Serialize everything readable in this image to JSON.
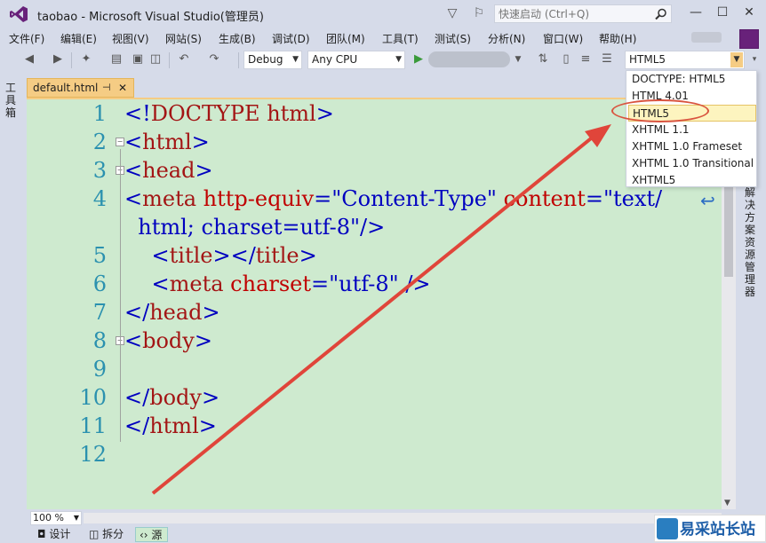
{
  "window": {
    "title": "taobao - Microsoft Visual Studio(管理员)",
    "quick_launch_placeholder": "快速启动 (Ctrl+Q)",
    "minimize": "—",
    "maximize": "☐",
    "close": "✕"
  },
  "menu": [
    "文件(F)",
    "编辑(E)",
    "视图(V)",
    "网站(S)",
    "生成(B)",
    "调试(D)",
    "团队(M)",
    "工具(T)",
    "测试(S)",
    "分析(N)",
    "窗口(W)",
    "帮助(H)"
  ],
  "toolbar": {
    "configuration": "Debug",
    "platform": "Any CPU",
    "schema": "HTML5"
  },
  "side_panels": {
    "toolbox": "工具箱",
    "solution_explorer": "解决方案资源管理器"
  },
  "tab": {
    "filename": "default.html",
    "pin": "⊣",
    "close": "✕"
  },
  "code_lines": [
    {
      "num": "1",
      "parts": [
        {
          "c": "t-tag",
          "t": "<!"
        },
        {
          "c": "t-name",
          "t": "DOCTYPE html"
        },
        {
          "c": "t-tag",
          "t": ">"
        }
      ]
    },
    {
      "num": "2",
      "parts": [
        {
          "c": "t-tag",
          "t": "<"
        },
        {
          "c": "t-name",
          "t": "html"
        },
        {
          "c": "t-tag",
          "t": ">"
        }
      ]
    },
    {
      "num": "3",
      "parts": [
        {
          "c": "t-tag",
          "t": "<"
        },
        {
          "c": "t-name",
          "t": "head"
        },
        {
          "c": "t-tag",
          "t": ">"
        }
      ]
    },
    {
      "num": "4",
      "parts": [
        {
          "c": "t-tag",
          "t": "<"
        },
        {
          "c": "t-name",
          "t": "meta "
        },
        {
          "c": "t-attr",
          "t": "http-equiv"
        },
        {
          "c": "t-tag",
          "t": "="
        },
        {
          "c": "t-val",
          "t": "\"Content-Type\" "
        },
        {
          "c": "t-attr",
          "t": "content"
        },
        {
          "c": "t-tag",
          "t": "="
        },
        {
          "c": "t-val",
          "t": "\"text/"
        }
      ]
    },
    {
      "num": "",
      "parts": [
        {
          "c": "t-val",
          "t": "  html; charset=utf-8\""
        },
        {
          "c": "t-tag",
          "t": "/>"
        }
      ]
    },
    {
      "num": "5",
      "parts": [
        {
          "c": "t-tag",
          "t": "    <"
        },
        {
          "c": "t-name",
          "t": "title"
        },
        {
          "c": "t-tag",
          "t": "></"
        },
        {
          "c": "t-name",
          "t": "title"
        },
        {
          "c": "t-tag",
          "t": ">"
        }
      ]
    },
    {
      "num": "6",
      "parts": [
        {
          "c": "t-tag",
          "t": "    <"
        },
        {
          "c": "t-name",
          "t": "meta "
        },
        {
          "c": "t-attr",
          "t": "charset"
        },
        {
          "c": "t-tag",
          "t": "="
        },
        {
          "c": "t-val",
          "t": "\"utf-8\" "
        },
        {
          "c": "t-tag",
          "t": "/>"
        }
      ]
    },
    {
      "num": "7",
      "parts": [
        {
          "c": "t-tag",
          "t": "</"
        },
        {
          "c": "t-name",
          "t": "head"
        },
        {
          "c": "t-tag",
          "t": ">"
        }
      ]
    },
    {
      "num": "8",
      "parts": [
        {
          "c": "t-tag",
          "t": "<"
        },
        {
          "c": "t-name",
          "t": "body"
        },
        {
          "c": "t-tag",
          "t": ">"
        }
      ]
    },
    {
      "num": "9",
      "parts": []
    },
    {
      "num": "10",
      "parts": [
        {
          "c": "t-tag",
          "t": "</"
        },
        {
          "c": "t-name",
          "t": "body"
        },
        {
          "c": "t-tag",
          "t": ">"
        }
      ]
    },
    {
      "num": "11",
      "parts": [
        {
          "c": "t-tag",
          "t": "</"
        },
        {
          "c": "t-name",
          "t": "html"
        },
        {
          "c": "t-tag",
          "t": ">"
        }
      ]
    },
    {
      "num": "12",
      "parts": []
    }
  ],
  "schema_dropdown": {
    "items": [
      "DOCTYPE: HTML5",
      "HTML 4.01",
      "HTML5",
      "XHTML 1.1",
      "XHTML 1.0 Frameset",
      "XHTML 1.0 Transitional",
      "XHTML5"
    ],
    "selected": "HTML5"
  },
  "bottom": {
    "zoom": "100 %",
    "views": [
      "设计",
      "拆分",
      "源"
    ],
    "active_view": "源"
  },
  "watermark": {
    "text": "易采站长站"
  },
  "colors": {
    "editor_bg": "#ceeacf",
    "tab_active": "#f5cc84",
    "annotation": "#e0453a",
    "vs_purple": "#68217a"
  }
}
